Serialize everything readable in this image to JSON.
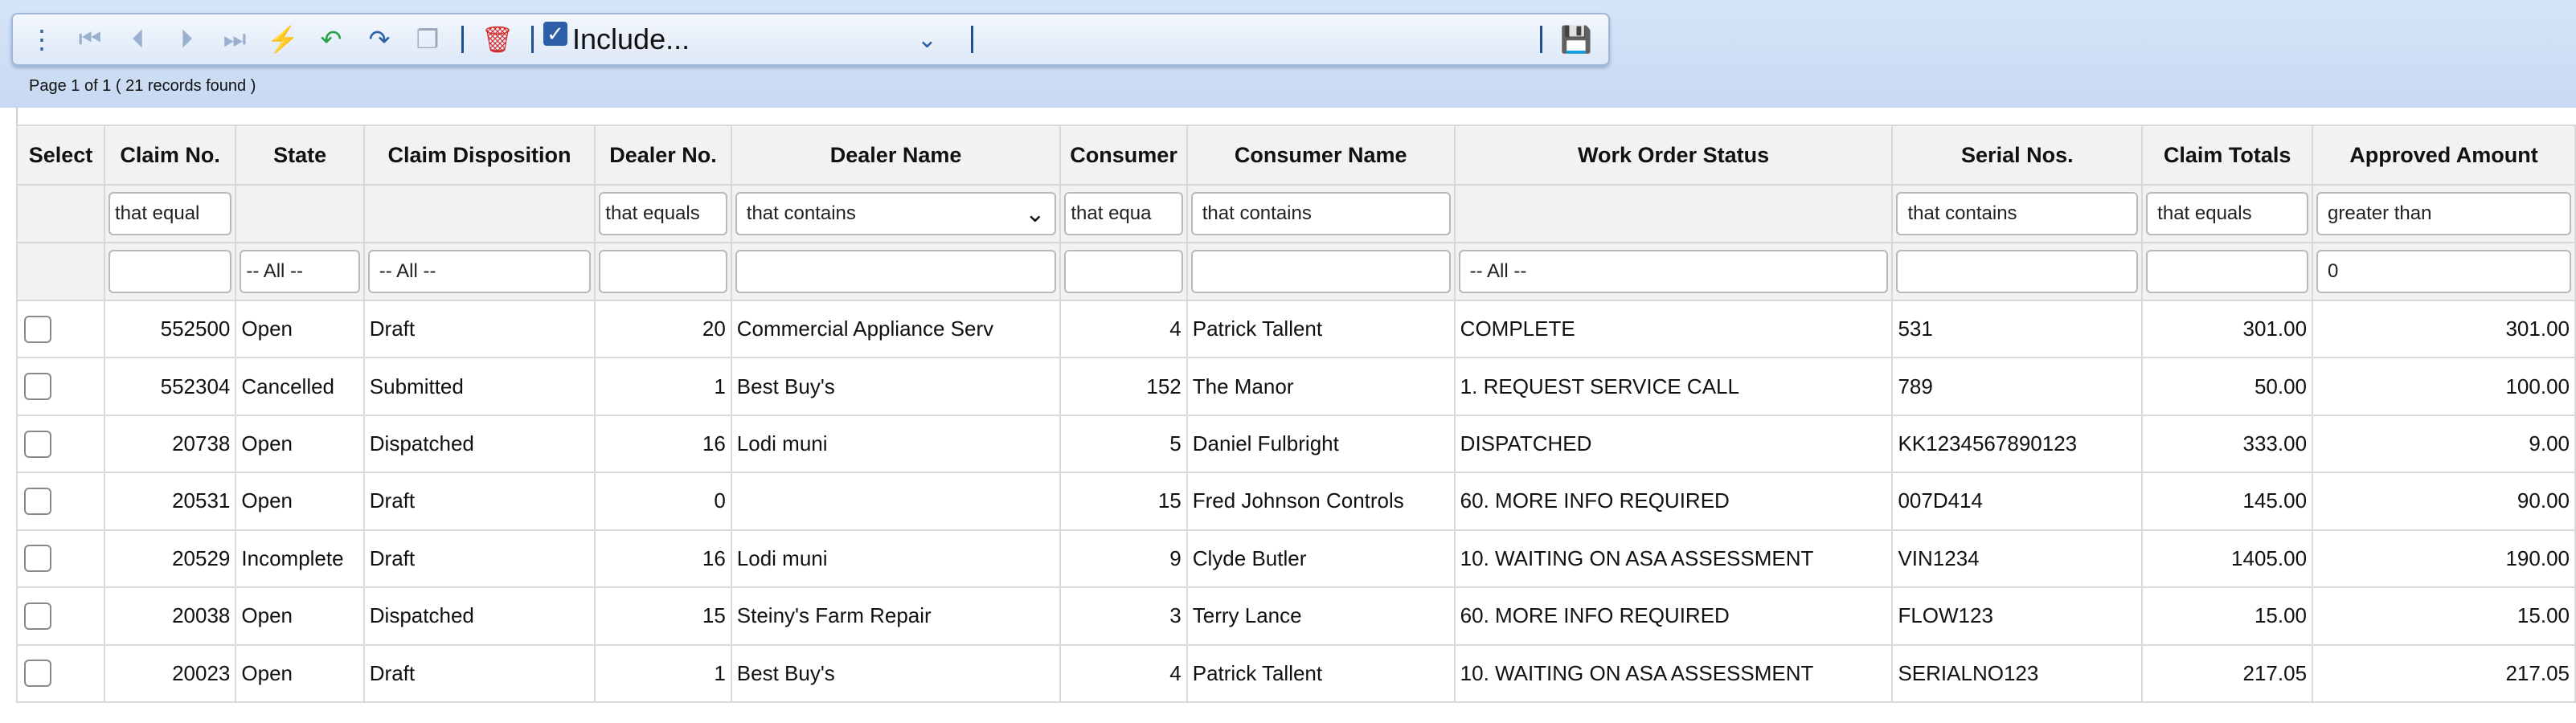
{
  "toolbar": {
    "icons": [
      "kebab-menu-icon",
      "first-page-icon",
      "previous-page-icon",
      "next-page-icon",
      "last-page-icon",
      "lightning-icon",
      "undo-icon",
      "redo-icon",
      "copy-icon",
      "delete-icon",
      "checkbox-icon",
      "save-icon"
    ],
    "include_label": "Include...",
    "page_info": "Page 1 of 1 ( 21 records found )"
  },
  "columns": [
    "Select",
    "Claim No.",
    "State",
    "Claim Disposition",
    "Dealer No.",
    "Dealer Name",
    "Consumer",
    "Consumer Name",
    "Work Order Status",
    "Serial Nos.",
    "Claim Totals",
    "Approved Amount"
  ],
  "filter_ops": {
    "claim_no": "that equal",
    "dealer_no": "that equals",
    "dealer_name": "that contains",
    "consumer": "that equa",
    "consumer_name": "that contains",
    "serial_nos": "that contains",
    "claim_totals": "that equals",
    "approved_amount": "greater than"
  },
  "filter_values": {
    "state": "-- All --",
    "claim_disposition": "-- All --",
    "work_order_status": "-- All --",
    "approved_amount": "0"
  },
  "rows": [
    {
      "claim_no": "552500",
      "state": "Open",
      "disposition": "Draft",
      "dealer_no": "20",
      "dealer_name": "Commercial Appliance Serv",
      "consumer": "4",
      "consumer_name": "Patrick Tallent",
      "status": "COMPLETE",
      "serial": "531",
      "claim_total": "301.00",
      "approved": "301.00"
    },
    {
      "claim_no": "552304",
      "state": "Cancelled",
      "disposition": "Submitted",
      "dealer_no": "1",
      "dealer_name": "Best Buy's",
      "consumer": "152",
      "consumer_name": "The Manor",
      "status": "1. REQUEST SERVICE CALL",
      "serial": "789",
      "claim_total": "50.00",
      "approved": "100.00"
    },
    {
      "claim_no": "20738",
      "state": "Open",
      "disposition": "Dispatched",
      "dealer_no": "16",
      "dealer_name": "Lodi muni",
      "consumer": "5",
      "consumer_name": "Daniel Fulbright",
      "status": "DISPATCHED",
      "serial": "KK1234567890123",
      "claim_total": "333.00",
      "approved": "9.00"
    },
    {
      "claim_no": "20531",
      "state": "Open",
      "disposition": "Draft",
      "dealer_no": "0",
      "dealer_name": "",
      "consumer": "15",
      "consumer_name": "Fred Johnson Controls",
      "status": "60. MORE INFO REQUIRED",
      "serial": "007D414",
      "claim_total": "145.00",
      "approved": "90.00"
    },
    {
      "claim_no": "20529",
      "state": "Incomplete",
      "disposition": "Draft",
      "dealer_no": "16",
      "dealer_name": "Lodi muni",
      "consumer": "9",
      "consumer_name": "Clyde Butler",
      "status": "10. WAITING ON ASA ASSESSMENT",
      "serial": "VIN1234",
      "claim_total": "1405.00",
      "approved": "190.00"
    },
    {
      "claim_no": "20038",
      "state": "Open",
      "disposition": "Dispatched",
      "dealer_no": "15",
      "dealer_name": "Steiny's Farm Repair",
      "consumer": "3",
      "consumer_name": "Terry Lance",
      "status": "60. MORE INFO REQUIRED",
      "serial": "FLOW123",
      "claim_total": "15.00",
      "approved": "15.00"
    },
    {
      "claim_no": "20023",
      "state": "Open",
      "disposition": "Draft",
      "dealer_no": "1",
      "dealer_name": "Best Buy's",
      "consumer": "4",
      "consumer_name": "Patrick Tallent",
      "status": "10. WAITING ON ASA ASSESSMENT",
      "serial": "SERIALNO123",
      "claim_total": "217.05",
      "approved": "217.05"
    }
  ]
}
